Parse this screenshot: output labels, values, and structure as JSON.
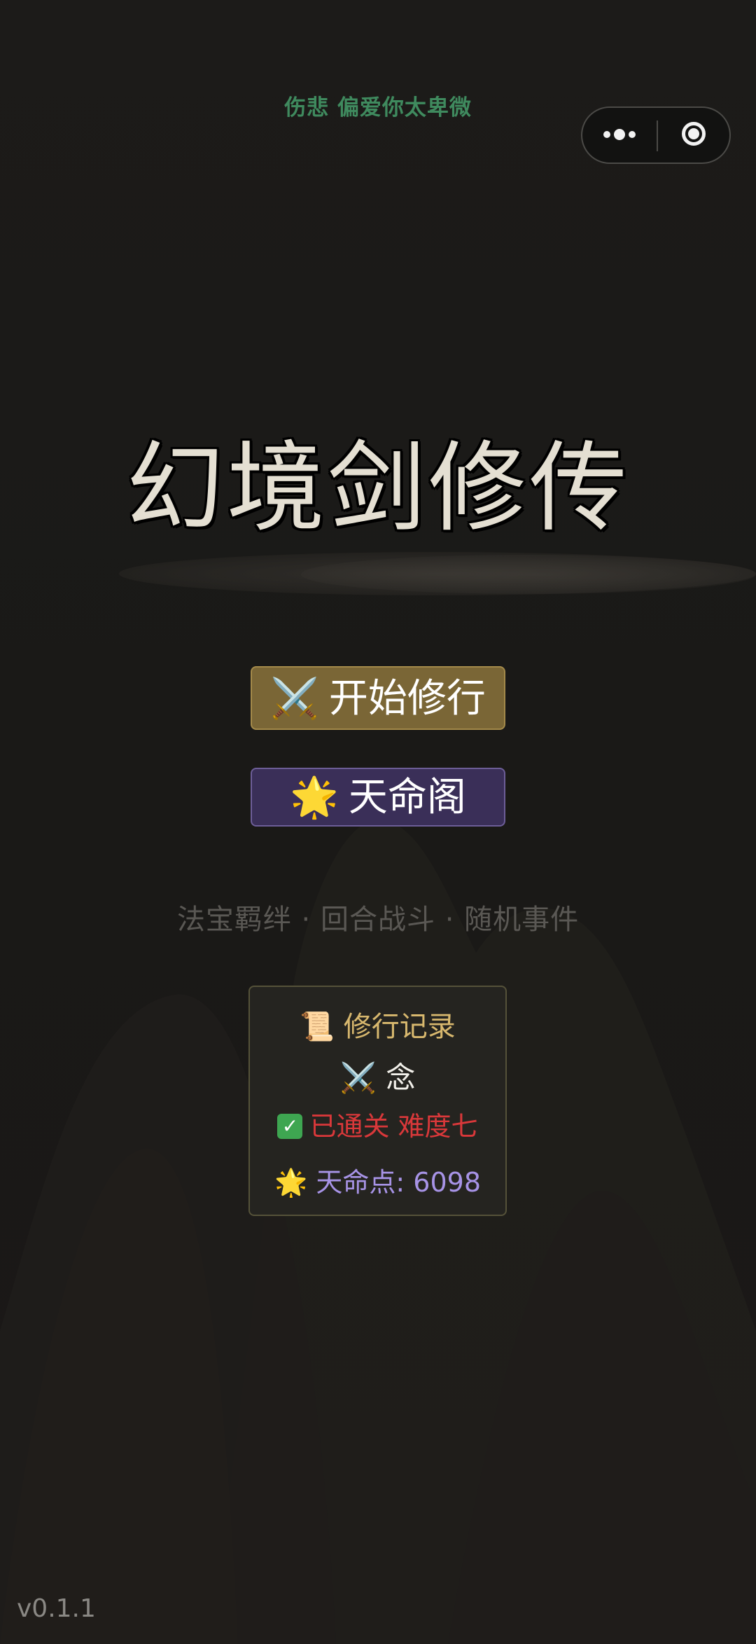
{
  "status_bar": {
    "text": "伤悲 偏爱你太卑微"
  },
  "capsule": {
    "more_icon": "more-dots-icon",
    "close_icon": "target-close-icon"
  },
  "game": {
    "title": "幻境剑修传"
  },
  "menu": {
    "start": {
      "emoji": "⚔️",
      "label": "开始修行"
    },
    "fate": {
      "emoji": "🌟",
      "label": "天命阁"
    }
  },
  "features": "法宝羁绊 · 回合战斗 · 随机事件",
  "record": {
    "title_emoji": "📜",
    "title": "修行记录",
    "name_emoji": "⚔️",
    "name": "念",
    "clear_check": "✓",
    "clear_text": "已通关 难度七",
    "fate_emoji": "🌟",
    "fate_points": "天命点: 6098"
  },
  "version": "v0.1.1",
  "colors": {
    "background": "#1b1a18",
    "start_button": "#7a6636",
    "fate_button": "#3a2f58",
    "accent_gold": "#d8b86e",
    "clear_red": "#d9383a",
    "fate_purple": "#a793e6",
    "status_green": "#3f8a5e"
  }
}
